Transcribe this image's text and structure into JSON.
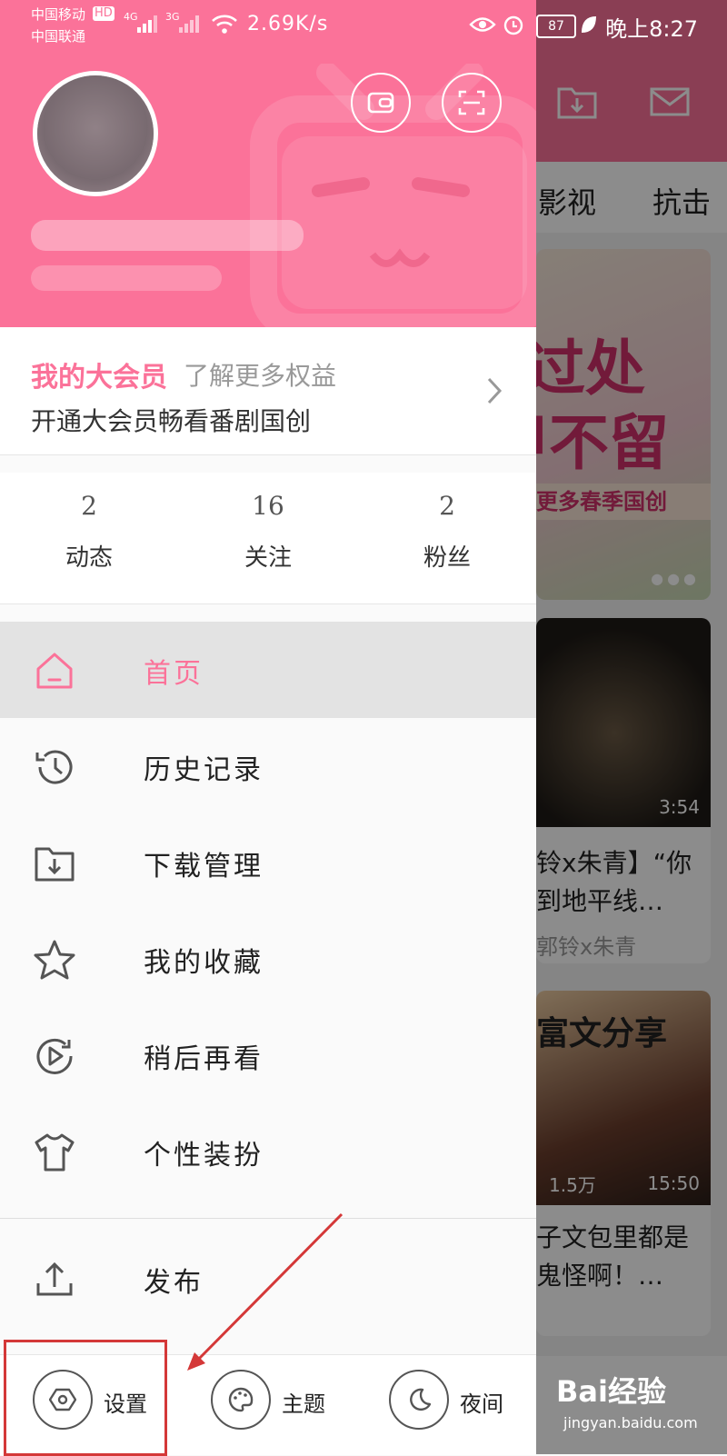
{
  "status_bar": {
    "carrier1": "中国移动",
    "hd": "HD",
    "carrier2": "中国联通",
    "sig4g": "4G",
    "sig3g": "3G",
    "net_speed": "2.69K/s",
    "battery": "87",
    "time": "晚上8:27"
  },
  "background_app": {
    "tabs": [
      "影视",
      "抗击"
    ],
    "banner": {
      "line1": "过处",
      "line2": "甲不留",
      "strip": "更多春季国创"
    },
    "card1": {
      "duration": "3:54",
      "title1": "铃x朱青】“你",
      "title2": "到地平线…",
      "author": "郭铃x朱青"
    },
    "card2": {
      "overlay": "富文分享",
      "views": "1.5万",
      "duration": "15:50",
      "title1": "子文包里都是",
      "title2": "鬼怪啊！…"
    }
  },
  "drawer": {
    "vip": {
      "title": "我的大会员",
      "more": "了解更多权益",
      "desc": "开通大会员畅看番剧国创"
    },
    "stats": [
      {
        "num": "2",
        "label": "动态"
      },
      {
        "num": "16",
        "label": "关注"
      },
      {
        "num": "2",
        "label": "粉丝"
      }
    ],
    "menu": [
      {
        "label": "首页",
        "icon": "home-icon"
      },
      {
        "label": "历史记录",
        "icon": "history-icon"
      },
      {
        "label": "下载管理",
        "icon": "download-folder-icon"
      },
      {
        "label": "我的收藏",
        "icon": "star-icon"
      },
      {
        "label": "稍后再看",
        "icon": "watch-later-icon"
      },
      {
        "label": "个性装扮",
        "icon": "tshirt-icon"
      }
    ],
    "publish": {
      "label": "发布",
      "icon": "upload-icon"
    },
    "footer": [
      {
        "label": "设置",
        "icon": "settings-icon"
      },
      {
        "label": "主题",
        "icon": "palette-icon"
      },
      {
        "label": "夜间",
        "icon": "moon-icon"
      }
    ]
  },
  "watermark": {
    "brand": "Bai经验",
    "url": "jingyan.baidu.com"
  },
  "colors": {
    "accent": "#fb7299",
    "annotation": "#d43838"
  }
}
